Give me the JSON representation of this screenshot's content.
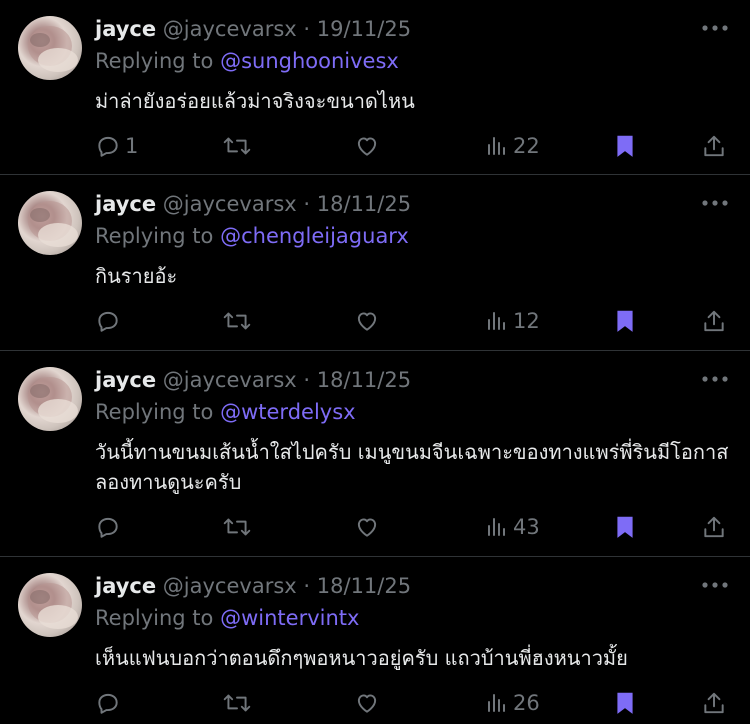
{
  "tweets": [
    {
      "name": "jayce",
      "handle": "@jaycevarsx",
      "separator": "·",
      "date": "19/11/25",
      "replying_prefix": "Replying to",
      "replying_to": "@sunghoonivesx",
      "text": "ม่าล่ายังอร่อยแล้วม่าจริงจะขนาดไหน",
      "reply_count": "1",
      "views": "22",
      "bookmarked": true
    },
    {
      "name": "jayce",
      "handle": "@jaycevarsx",
      "separator": "·",
      "date": "18/11/25",
      "replying_prefix": "Replying to",
      "replying_to": "@chengleijaguarx",
      "text": "กินรายอ้ะ",
      "reply_count": "",
      "views": "12",
      "bookmarked": true
    },
    {
      "name": "jayce",
      "handle": "@jaycevarsx",
      "separator": "·",
      "date": "18/11/25",
      "replying_prefix": "Replying to",
      "replying_to": "@wterdelysx",
      "text": "วันนี้ทานขนมเส้นน้ำใสไปครับ เมนูขนมจีนเฉพาะของทางแพร่พี่รินมีโอกาสลองทานดูนะครับ",
      "reply_count": "",
      "views": "43",
      "bookmarked": true
    },
    {
      "name": "jayce",
      "handle": "@jaycevarsx",
      "separator": "·",
      "date": "18/11/25",
      "replying_prefix": "Replying to",
      "replying_to": "@wintervintx",
      "text": "เห็นแฟนบอกว่าตอนดึกๆพอหนาวอยู่ครับ แถวบ้านพี่ฮงหนาวมั้ย",
      "reply_count": "",
      "views": "26",
      "bookmarked": true
    }
  ],
  "icons": {
    "reply": "reply-icon",
    "retweet": "retweet-icon",
    "like": "heart-icon",
    "views": "views-icon",
    "bookmark": "bookmark-icon",
    "share": "share-icon",
    "more": "more-icon"
  },
  "colors": {
    "background": "#000000",
    "text_primary": "#e7e9ea",
    "text_secondary": "#71767b",
    "mention": "#7e6cf6",
    "bookmark": "#7e6cf6",
    "divider": "#2f3336"
  }
}
